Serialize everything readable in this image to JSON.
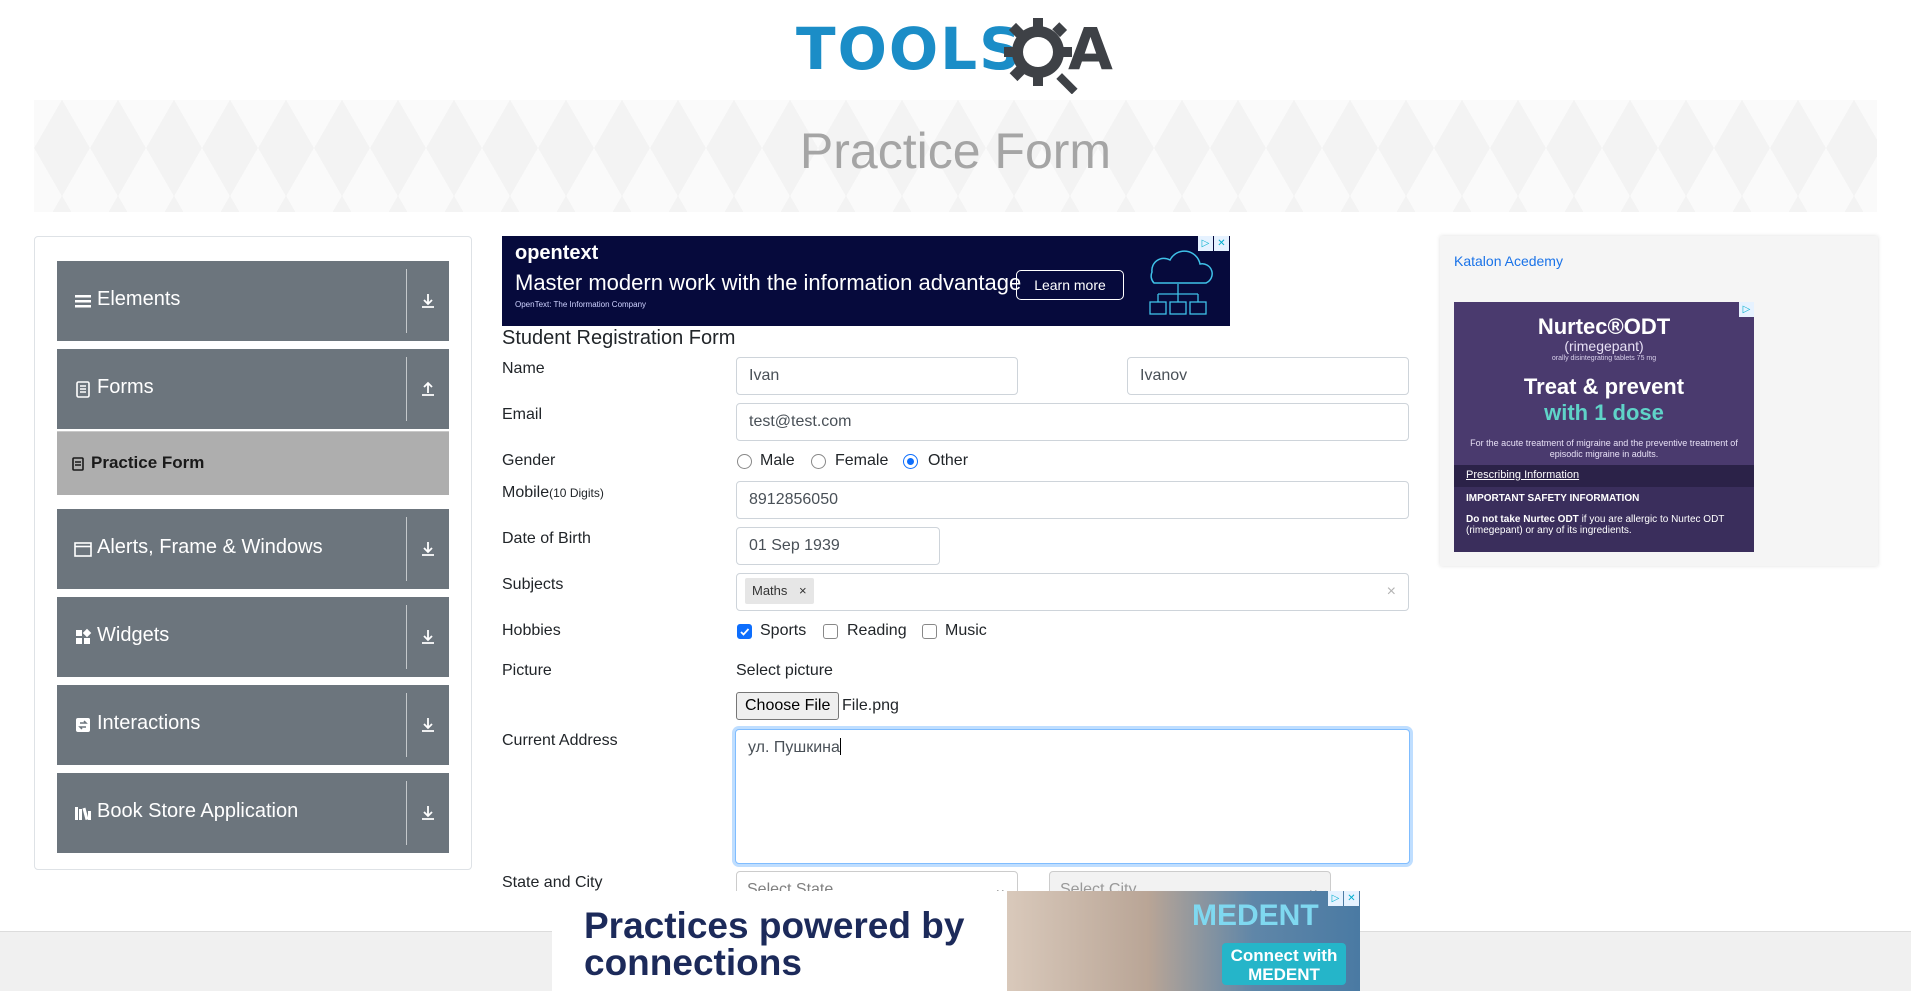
{
  "logo": {
    "text": "TOOLS",
    "text2": "A",
    "gear_icon": "magnifier-gear-icon"
  },
  "banner": {
    "title": "Practice Form"
  },
  "sidebar": {
    "groups": [
      {
        "label": "Elements",
        "icon": "menu-icon",
        "arrow": "download-arrow-icon"
      },
      {
        "label": "Forms",
        "icon": "document-icon",
        "arrow": "upload-arrow-icon"
      },
      {
        "label": "Alerts, Frame & Windows",
        "icon": "window-icon",
        "arrow": "download-arrow-icon"
      },
      {
        "label": "Widgets",
        "icon": "widgets-icon",
        "arrow": "download-arrow-icon"
      },
      {
        "label": "Interactions",
        "icon": "interactions-icon",
        "arrow": "download-arrow-icon"
      },
      {
        "label": "Book Store Application",
        "icon": "books-icon",
        "arrow": "download-arrow-icon"
      }
    ],
    "active_item": "Practice Form"
  },
  "ad_top": {
    "brand": "opentext",
    "brand_sub": "OpenText: The Information Company",
    "message": "Master modern work with the information advantage",
    "cta": "Learn more"
  },
  "ad_right": {
    "katalon_alt": "Katalon Acedemy",
    "name": "Nurtec®ODT",
    "sub": "(rimegepant)",
    "tiny": "orally disintegrating tablets 75 mg",
    "headline1": "Treat & prevent",
    "headline2": "with 1 dose",
    "desc": "For the acute treatment of migraine and the preventive treatment of episodic migraine in adults.",
    "link": "Prescribing Information",
    "safety_title": "IMPORTANT SAFETY INFORMATION",
    "safety_bold": "Do not take Nurtec ODT",
    "safety_text": "if you are allergic to Nurtec ODT (rimegepant) or any of its ingredients."
  },
  "ad_bottom": {
    "message": "Practices powered by connections",
    "brand": "MEDENT",
    "cta": "Connect with MEDENT"
  },
  "form": {
    "title": "Student Registration Form",
    "labels": {
      "name": "Name",
      "email": "Email",
      "gender": "Gender",
      "mobile": "Mobile",
      "mobile_hint": "(10 Digits)",
      "dob": "Date of Birth",
      "subjects": "Subjects",
      "hobbies": "Hobbies",
      "picture": "Picture",
      "address": "Current Address",
      "state_city": "State and City"
    },
    "first_name": "Ivan",
    "last_name": "Ivanov",
    "email": "test@test.com",
    "gender_options": [
      "Male",
      "Female",
      "Other"
    ],
    "gender_selected": "Other",
    "mobile": "8912856050",
    "dob": "01 Sep 1939",
    "subject_chip": "Maths",
    "hobby_options": [
      "Sports",
      "Reading",
      "Music"
    ],
    "hobbies_selected": [
      "Sports"
    ],
    "picture_label": "Select picture",
    "choose_file": "Choose File",
    "file_name": "File.png",
    "address": "ул. Пушкина",
    "state_placeholder": "Select State",
    "city_placeholder": "Select City"
  }
}
